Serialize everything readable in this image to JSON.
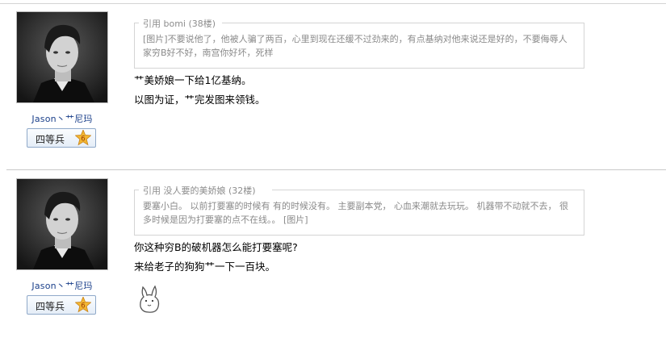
{
  "posts": [
    {
      "username": "Jason丶艹尼玛",
      "rank": "四等兵",
      "rank_level": "6",
      "quote_author_prefix": "引用",
      "quote_author": "bomi",
      "quote_floor": "(38楼)",
      "quote_text": "[图片]不要说他了，他被人骗了两百，心里到现在还缓不过劲来的，有点基纳对他来说还是好的，不要侮辱人家穷B好不好，南宫你好坏，死样",
      "lines": [
        "艹美娇娘一下给1亿基纳。",
        "以图为证，艹完发图来领钱。"
      ]
    },
    {
      "username": "Jason丶艹尼玛",
      "rank": "四等兵",
      "rank_level": "6",
      "quote_author_prefix": "引用",
      "quote_author": "没人要的美娇娘",
      "quote_floor": "(32楼)",
      "quote_text": "要塞小白。 以前打要塞的时候有 有的时候没有。 主要副本党， 心血来潮就去玩玩。 机器带不动就不去， 很多时候是因为打要塞的点不在线。。 [图片]",
      "lines": [
        "你这种穷B的破机器怎么能打要塞呢?",
        "来给老子的狗狗艹一下一百块。"
      ]
    }
  ]
}
